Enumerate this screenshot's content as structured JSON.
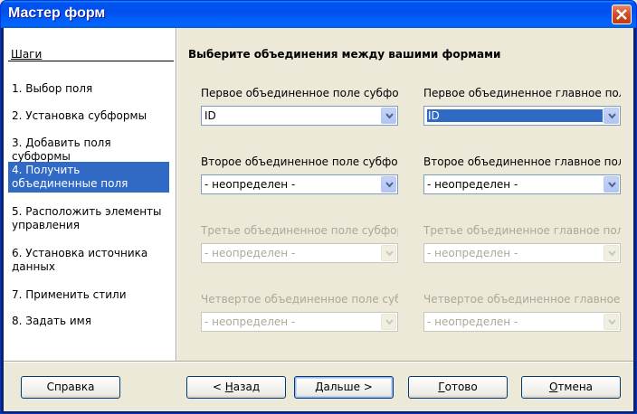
{
  "window": {
    "title": "Мастер форм"
  },
  "steps": {
    "title": "Шаги",
    "items": [
      {
        "label": "1. Выбор поля"
      },
      {
        "label": "2. Установка субформы"
      },
      {
        "label": "3. Добавить поля субформы"
      },
      {
        "label": "4. Получить объединенные поля",
        "active": true
      },
      {
        "label": "5. Расположить элементы управления"
      },
      {
        "label": "6. Установка источника данных"
      },
      {
        "label": "7. Применить стили"
      },
      {
        "label": "8. Задать имя"
      }
    ]
  },
  "main": {
    "title": "Выберите объединения между вашими формами",
    "fields": {
      "f1_sub_label": "Первое объединенное поле субформы",
      "f1_sub_value": "ID",
      "f1_main_label": "Первое объединенное главное поле",
      "f1_main_value": "ID",
      "f2_sub_label": "Второе объединенное поле субформы",
      "f2_sub_value": "- неопределен -",
      "f2_main_label": "Второе объединенное главное поле",
      "f2_main_value": "- неопределен -",
      "f3_sub_label": "Третье объединенное поле субформы",
      "f3_sub_value": "- неопределен -",
      "f3_main_label": "Третье объединенное главное поле",
      "f3_main_value": "- неопределен -",
      "f4_sub_label": "Четвертое объединенное поле субформы",
      "f4_sub_value": "- неопределен -",
      "f4_main_label": "Четвертое объединенное главное поле",
      "f4_main_value": "- неопределен -"
    }
  },
  "buttons": {
    "help": "Справка",
    "back_prefix": "< ",
    "back_acc": "Н",
    "back_rest": "азад",
    "next_acc": "Д",
    "next_rest": "альше >",
    "finish_acc": "Г",
    "finish_rest": "отово",
    "cancel_acc": "О",
    "cancel_rest": "тмена"
  },
  "colors": {
    "title_bar": "#0054e3",
    "selection": "#316ac5",
    "dialog_bg": "#ece9d8"
  }
}
